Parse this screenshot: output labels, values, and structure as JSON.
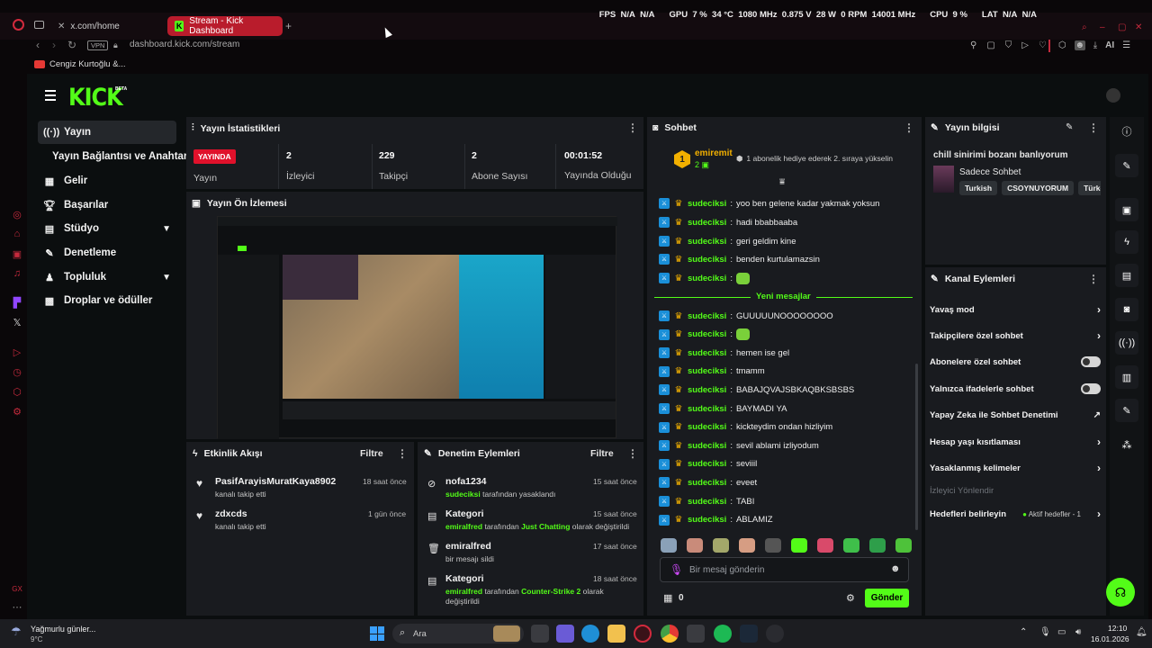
{
  "browser": {
    "tabs": [
      {
        "label": "x.com/home"
      },
      {
        "label": "Stream - Kick Dashboard"
      }
    ],
    "new_tab": "+",
    "vpn": "VPN",
    "url": "dashboard.kick.com/stream",
    "bookmark": "Cengiz Kurtoğlu &...",
    "hud": {
      "fps_label": "FPS",
      "fps1": "N/A",
      "fps2": "N/A",
      "gpu_label": "GPU",
      "gpu_load": "7 %",
      "gpu_temp": "34 °C",
      "gpu_clock": "1080 MHz",
      "gpu_volt": "0.875 V",
      "gpu_power": "28 W",
      "gpu_fan": "0 RPM",
      "gpu_mem": "14001 MHz",
      "cpu_label": "CPU",
      "cpu_load": "9 %",
      "lat_label": "LAT",
      "lat1": "N/A",
      "lat2": "N/A"
    },
    "ai_label": "AI"
  },
  "kick": {
    "logo": "KICK",
    "beta": "BETA",
    "nav": [
      {
        "label": "Yayın",
        "icon": "broadcast-icon"
      },
      {
        "label": "Yayın Bağlantısı ve Anahtarı",
        "icon": ""
      },
      {
        "label": "Gelir",
        "icon": "revenue-icon"
      },
      {
        "label": "Başarılar",
        "icon": "trophy-icon"
      },
      {
        "label": "Stüdyo",
        "icon": "studio-icon"
      },
      {
        "label": "Denetleme",
        "icon": "wrench-icon"
      },
      {
        "label": "Topluluk",
        "icon": "community-icon"
      },
      {
        "label": "Droplar ve ödüller",
        "icon": "gift-icon"
      }
    ],
    "stats": {
      "title": "Yayın İstatistikleri",
      "live_badge": "YAYINDA",
      "live_label": "Yayın",
      "items": [
        {
          "value": "2",
          "label": "İzleyici"
        },
        {
          "value": "229",
          "label": "Takipçi"
        },
        {
          "value": "2",
          "label": "Abone Sayısı"
        },
        {
          "value": "00:01:52",
          "label": "Yayında Olduğu Süre"
        }
      ]
    },
    "preview": {
      "title": "Yayın Ön İzlemesi"
    },
    "activity": {
      "title": "Etkinlik Akışı",
      "filter": "Filtre",
      "items": [
        {
          "name": "PasifArayisMuratKaya8902",
          "sub": "kanalı takip etti",
          "time": "18 saat önce"
        },
        {
          "name": "zdxcds",
          "sub": "kanalı takip etti",
          "time": "1 gün önce"
        }
      ]
    },
    "moderation": {
      "title": "Denetim Eylemleri",
      "filter": "Filtre",
      "items": [
        {
          "name": "nofa1234",
          "who": "sudeciksi",
          "rest": " tarafından yasaklandı",
          "time": "15 saat önce"
        },
        {
          "name": "Kategori",
          "who": "emiralfred",
          "rest": " tarafından ",
          "hl": "Just Chatting",
          "rest2": " olarak değiştirildi",
          "time": "15 saat önce"
        },
        {
          "name": "emiralfred",
          "who": "",
          "rest": "bir mesajı sildi",
          "time": "17 saat önce"
        },
        {
          "name": "Kategori",
          "who": "emiralfred",
          "rest": " tarafından ",
          "hl": "Counter-Strike 2",
          "rest2": " olarak değiştirildi",
          "time": "18 saat önce"
        }
      ]
    },
    "chat": {
      "title": "Sohbet",
      "pinned_user": "emiremit",
      "pinned_rank": "1",
      "pinned_count": "2",
      "pinned_msg": "1 abonelik hediye ederek 2. sıraya yükselin",
      "new_messages": "Yeni mesajlar",
      "user": "sudeciksi",
      "before": [
        "yoo ben gelene kadar yakmak yoksun",
        "hadi bbabbaaba",
        "geri geldim kine",
        "benden kurtulamazsin",
        ""
      ],
      "after": [
        "GUUUUUNOOOOOOOO",
        "",
        "hemen ise gel",
        "tmamm",
        "BABAJQVAJSBKAQBKSBSBS",
        "BAYMADI YA",
        "kickteydim ondan hizliyim",
        "sevil ablami izliyodum",
        "seviiil",
        "eveet",
        "TABI",
        "ABLAMIZ"
      ],
      "placeholder": "Bir mesaj gönderin",
      "count": "0",
      "send": "Gönder"
    },
    "info": {
      "title": "Yayın bilgisi",
      "stream_title": "chill sinirimi bozanı banlıyorum",
      "category": "Sadece Sohbet",
      "tags": [
        "Turkish",
        "CSOYNUYORUM",
        "Türkç"
      ]
    },
    "channel_actions": {
      "title": "Kanal Eylemleri",
      "items": [
        {
          "label": "Yavaş mod",
          "type": "arrow"
        },
        {
          "label": "Takipçilere özel sohbet",
          "type": "arrow"
        },
        {
          "label": "Abonelere özel sohbet",
          "type": "toggle"
        },
        {
          "label": "Yalnızca ifadelerle sohbet",
          "type": "toggle"
        },
        {
          "label": "Yapay Zeka ile Sohbet Denetimi",
          "type": "ext"
        },
        {
          "label": "Hesap yaşı kısıtlaması",
          "type": "arrow"
        },
        {
          "label": "Yasaklanmış kelimeler",
          "type": "arrow"
        },
        {
          "label": "İzleyici Yönlendir",
          "type": "disabled"
        },
        {
          "label": "Hedefleri belirleyin",
          "type": "goal"
        }
      ],
      "goal_text": "Aktif hedefler - 1"
    }
  },
  "taskbar": {
    "weather": "Yağmurlu günler...",
    "temp": "9°C",
    "search": "Ara",
    "time": "12:10",
    "date": "16.01.2026"
  },
  "colors": {
    "kick_green": "#53fc18",
    "live_red": "#e0112b",
    "opera_red": "#c62a3d"
  }
}
